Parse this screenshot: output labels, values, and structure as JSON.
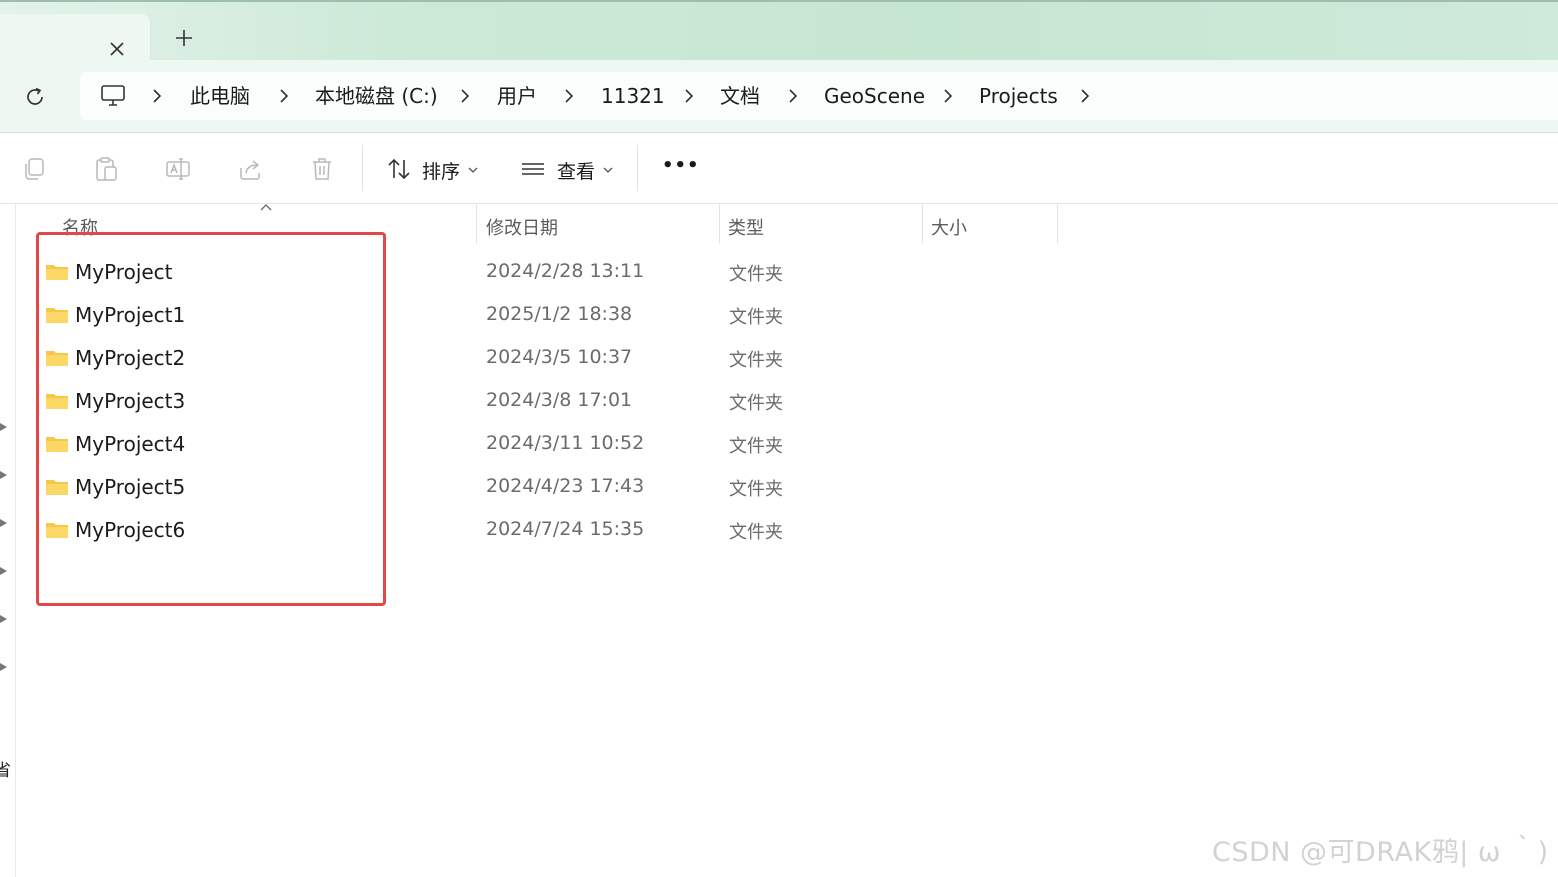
{
  "tabs": {
    "close_icon": "close-icon",
    "new_tab_icon": "plus-icon"
  },
  "address": {
    "breadcrumbs": [
      {
        "label": "此电脑"
      },
      {
        "label": "本地磁盘 (C:)"
      },
      {
        "label": "用户"
      },
      {
        "label": "11321"
      },
      {
        "label": "文档"
      },
      {
        "label": "GeoScene"
      },
      {
        "label": "Projects"
      }
    ]
  },
  "toolbar": {
    "sort_label": "排序",
    "view_label": "查看",
    "more_label": "•••"
  },
  "columns": {
    "name": "名称",
    "modified": "修改日期",
    "type": "类型",
    "size": "大小"
  },
  "files": [
    {
      "name": "MyProject",
      "modified": "2024/2/28 13:11",
      "type": "文件夹"
    },
    {
      "name": "MyProject1",
      "modified": "2025/1/2 18:38",
      "type": "文件夹"
    },
    {
      "name": "MyProject2",
      "modified": "2024/3/5 10:37",
      "type": "文件夹"
    },
    {
      "name": "MyProject3",
      "modified": "2024/3/8 17:01",
      "type": "文件夹"
    },
    {
      "name": "MyProject4",
      "modified": "2024/3/11 10:52",
      "type": "文件夹"
    },
    {
      "name": "MyProject5",
      "modified": "2024/4/23 17:43",
      "type": "文件夹"
    },
    {
      "name": "MyProject6",
      "modified": "2024/7/24 15:35",
      "type": "文件夹"
    }
  ],
  "nav": {
    "partial_label": "省"
  },
  "watermark": "CSDN @可DRAK鸦| ω ｀)",
  "colors": {
    "highlight": "#e34848",
    "folder": "#f5c84c",
    "accent_green": "#c5e6d2"
  }
}
